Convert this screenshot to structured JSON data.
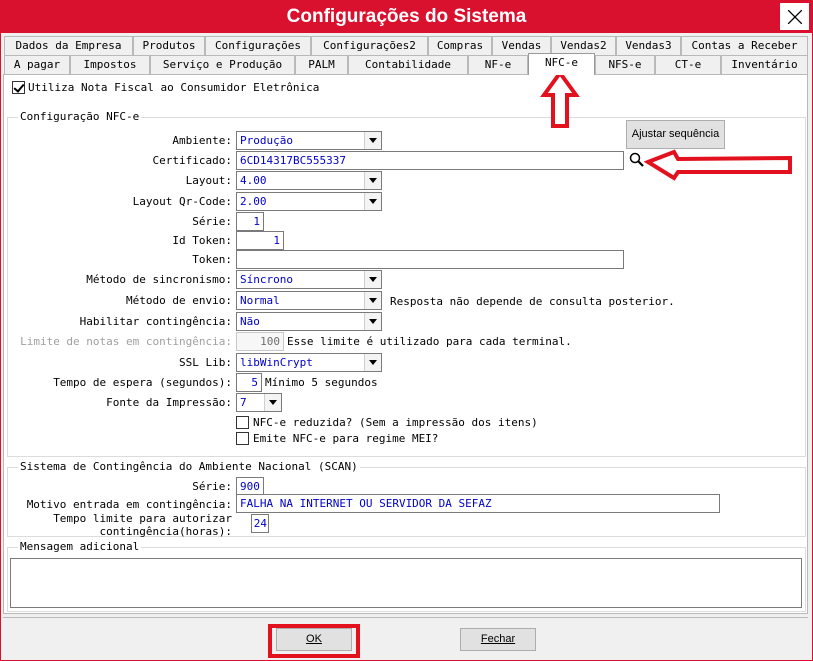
{
  "window": {
    "title": "Configurações do Sistema"
  },
  "tabs_row1": [
    "Dados da Empresa",
    "Produtos",
    "Configurações",
    "Configurações2",
    "Compras",
    "Vendas",
    "Vendas2",
    "Vendas3",
    "Contas a Receber"
  ],
  "tabs_row2": [
    "A pagar",
    "Impostos",
    "Serviço e Produção",
    "PALM",
    "Contabilidade",
    "NF-e",
    "NFC-e",
    "NFS-e",
    "CT-e",
    "Inventário"
  ],
  "active_tab": "NFC-e",
  "top_checkbox": {
    "label": "Utiliza Nota Fiscal ao Consumidor Eletrônica",
    "checked": true
  },
  "nfce_group": {
    "title": "Configuração NFC-e",
    "adjust_button": "Ajustar sequência",
    "ambiente": {
      "label": "Ambiente:",
      "value": "Produção"
    },
    "certificado": {
      "label": "Certificado:",
      "value": "6CD14317BC555337"
    },
    "layout": {
      "label": "Layout:",
      "value": "4.00"
    },
    "layout_qr": {
      "label": "Layout Qr-Code:",
      "value": "2.00"
    },
    "serie": {
      "label": "Série:",
      "value": "1"
    },
    "id_token": {
      "label": "Id Token:",
      "value": "1"
    },
    "token": {
      "label": "Token:",
      "value": ""
    },
    "metodo_sinc": {
      "label": "Método de sincronismo:",
      "value": "Síncrono"
    },
    "metodo_envio": {
      "label": "Método de envio:",
      "value": "Normal",
      "note": "Resposta não depende de consulta posterior."
    },
    "contingencia": {
      "label": "Habilitar contingência:",
      "value": "Não"
    },
    "limite": {
      "label": "Limite de notas em contingência:",
      "value": "100",
      "note": "Esse limite é utilizado para cada terminal."
    },
    "ssl": {
      "label": "SSL Lib:",
      "value": "libWinCrypt"
    },
    "tempo": {
      "label": "Tempo de espera (segundos):",
      "value": "5",
      "note": "Mínimo 5 segundos"
    },
    "fonte": {
      "label": "Fonte da Impressão:",
      "value": "7"
    },
    "reduzida": {
      "label": "NFC-e reduzida? (Sem a impressão dos itens)",
      "checked": false
    },
    "mei": {
      "label": "Emite NFC-e para regime MEI?",
      "checked": false
    }
  },
  "scan_group": {
    "title": "Sistema de Contingência do Ambiente Nacional (SCAN)",
    "serie": {
      "label": "Série:",
      "value": "900"
    },
    "motivo": {
      "label": "Motivo entrada em contingência:",
      "value": "FALHA NA INTERNET OU SERVIDOR DA SEFAZ"
    },
    "tempo_limite": {
      "label_line1": "Tempo limite para autorizar",
      "label_line2": "contingência(horas):",
      "value": "24"
    }
  },
  "msg_group": {
    "title": "Mensagem adicional",
    "value": ""
  },
  "buttons": {
    "ok": "OK",
    "fechar": "Fechar"
  },
  "colors": {
    "title_bar": "#d9102e",
    "annotation": "#e3101e",
    "field_text": "#0000c8"
  }
}
